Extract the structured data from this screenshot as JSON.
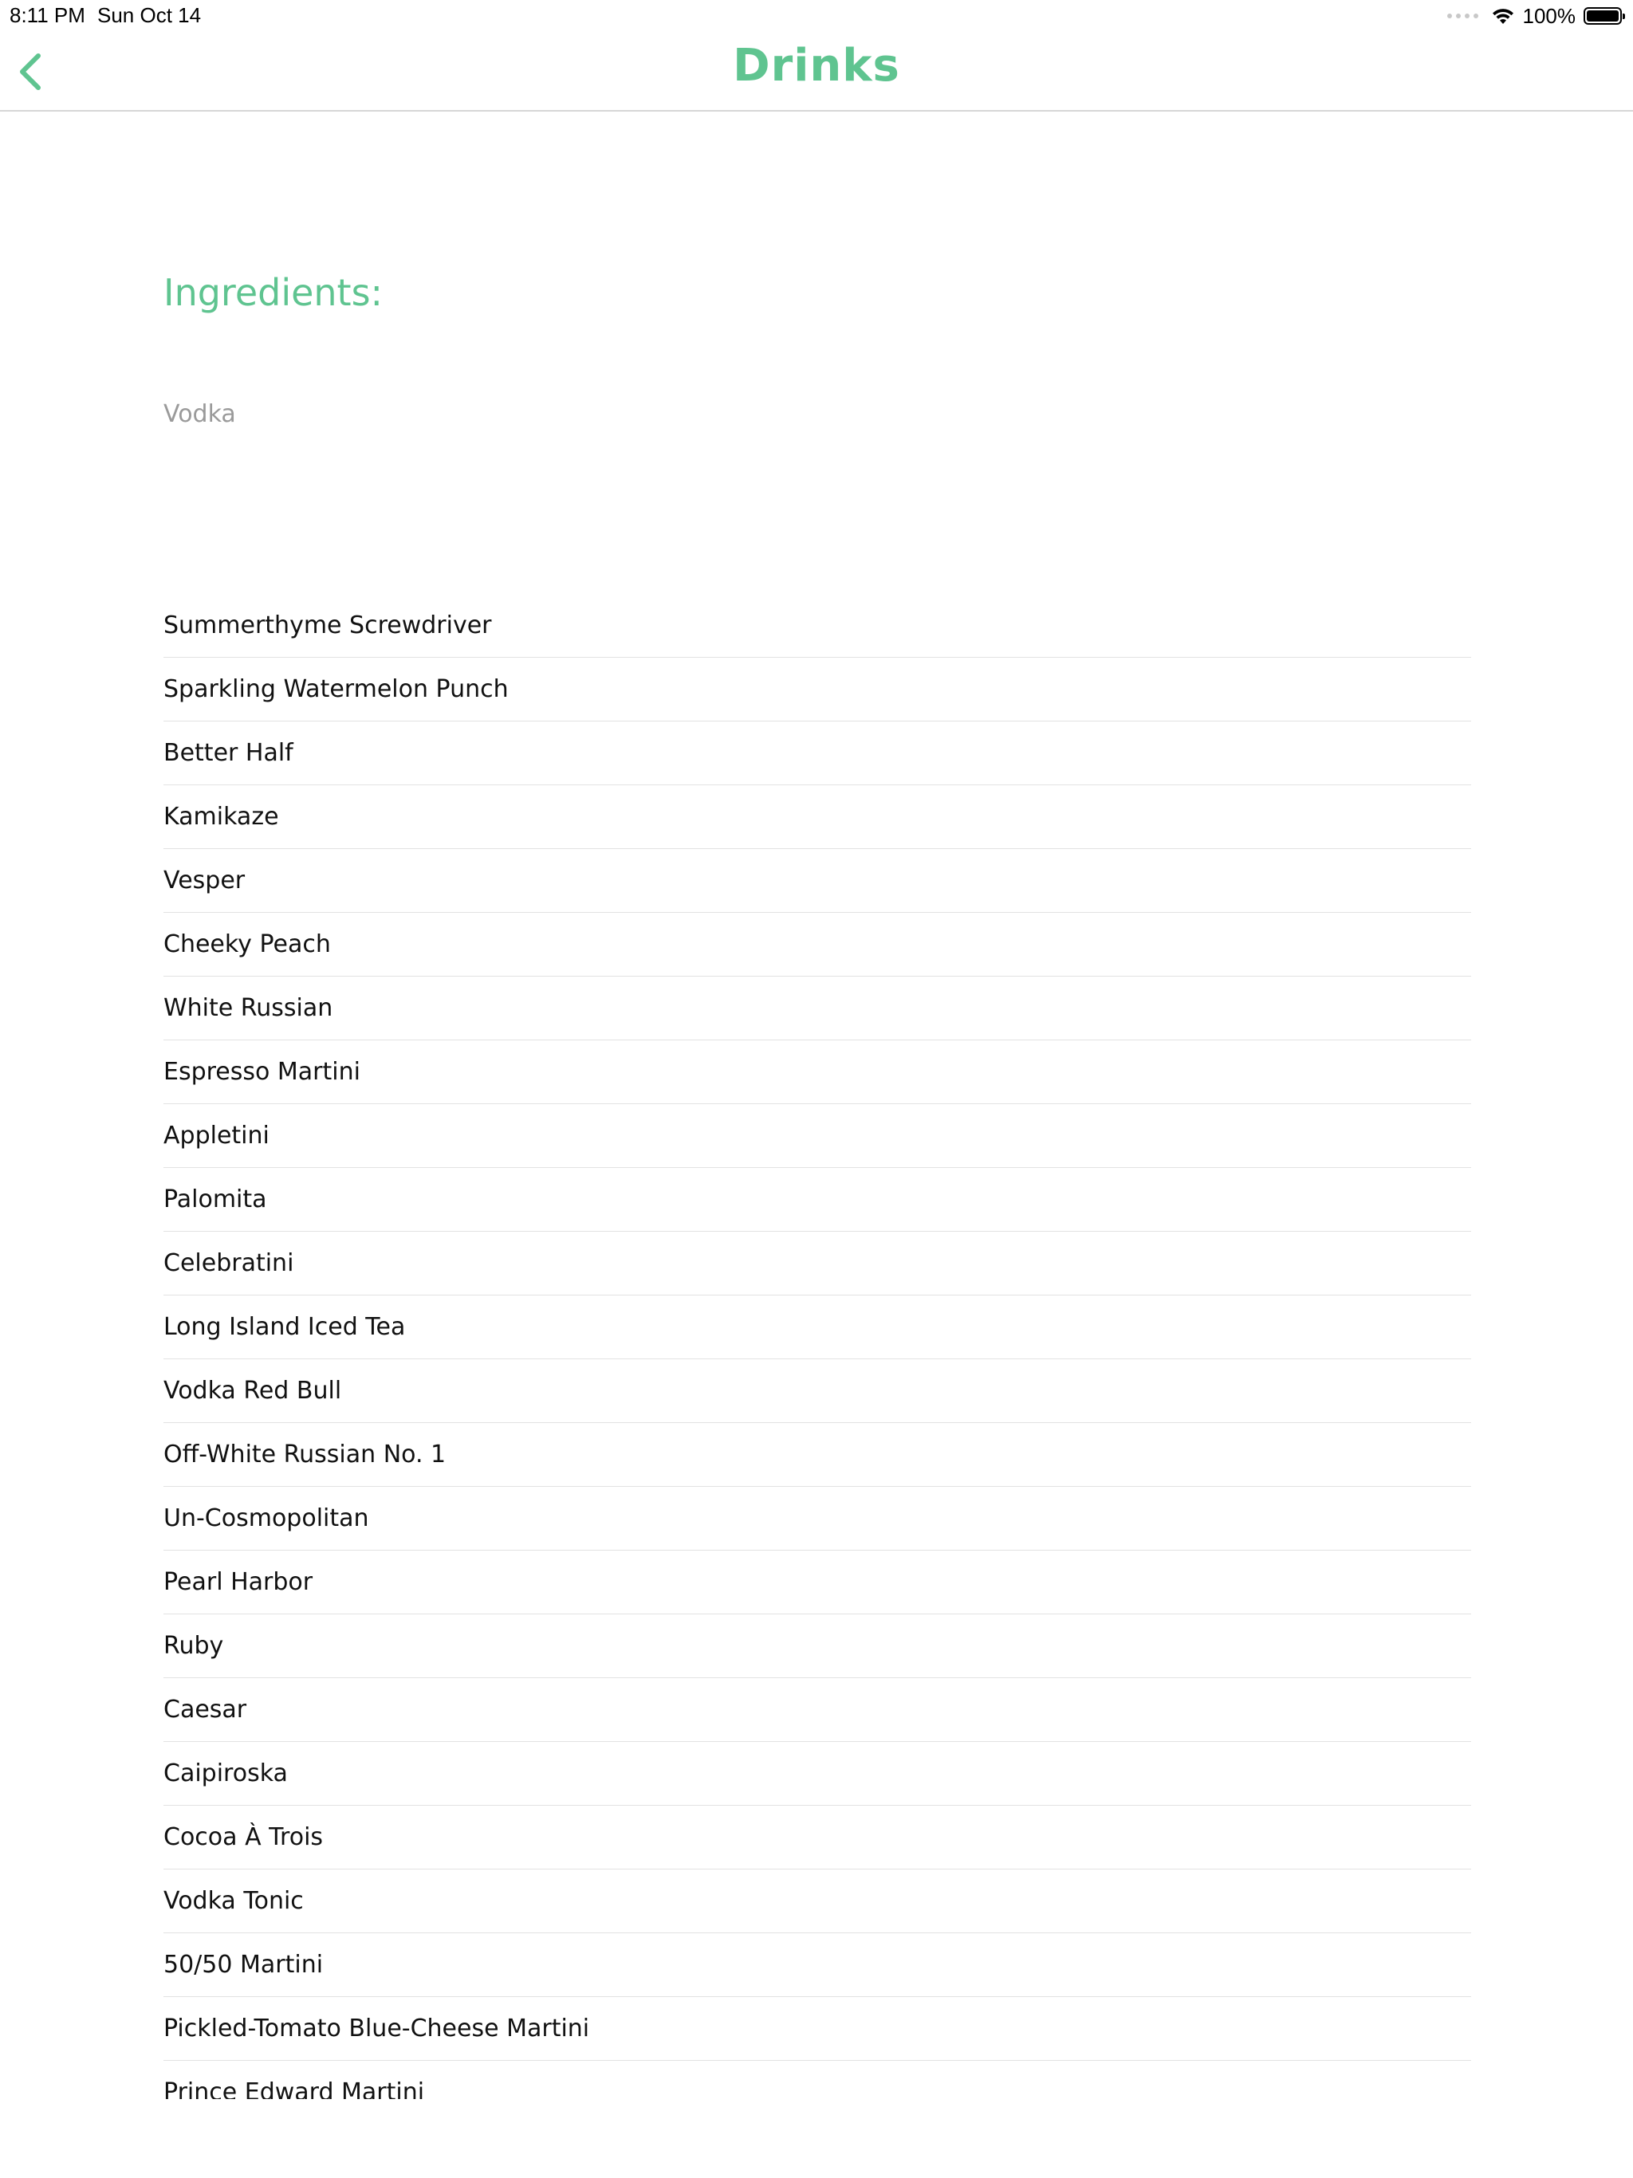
{
  "status_bar": {
    "time": "8:11 PM",
    "date": "Sun Oct 14",
    "battery": "100%",
    "battery_level": 1.0
  },
  "nav": {
    "title": "Drinks",
    "back_icon": "chevron-left-icon"
  },
  "ingredients": {
    "heading": "Ingredients:",
    "text": "Vodka"
  },
  "drinks": [
    "Summerthyme Screwdriver",
    "Sparkling Watermelon Punch",
    "Better Half",
    "Kamikaze",
    "Vesper",
    "Cheeky Peach",
    "White Russian",
    "Espresso Martini",
    "Appletini",
    "Palomita",
    "Celebratini",
    "Long Island Iced Tea",
    "Vodka Red Bull",
    "Off-White Russian No. 1",
    "Un-Cosmopolitan",
    "Pearl Harbor",
    "Ruby",
    "Caesar",
    "Caipiroska",
    "Cocoa À Trois",
    "Vodka Tonic",
    "50/50 Martini",
    "Pickled-Tomato Blue-Cheese Martini",
    "Prince Edward Martini"
  ],
  "colors": {
    "accent": "#5fc490",
    "muted_text": "#9a9a9a",
    "separator": "#e2e2e2"
  }
}
